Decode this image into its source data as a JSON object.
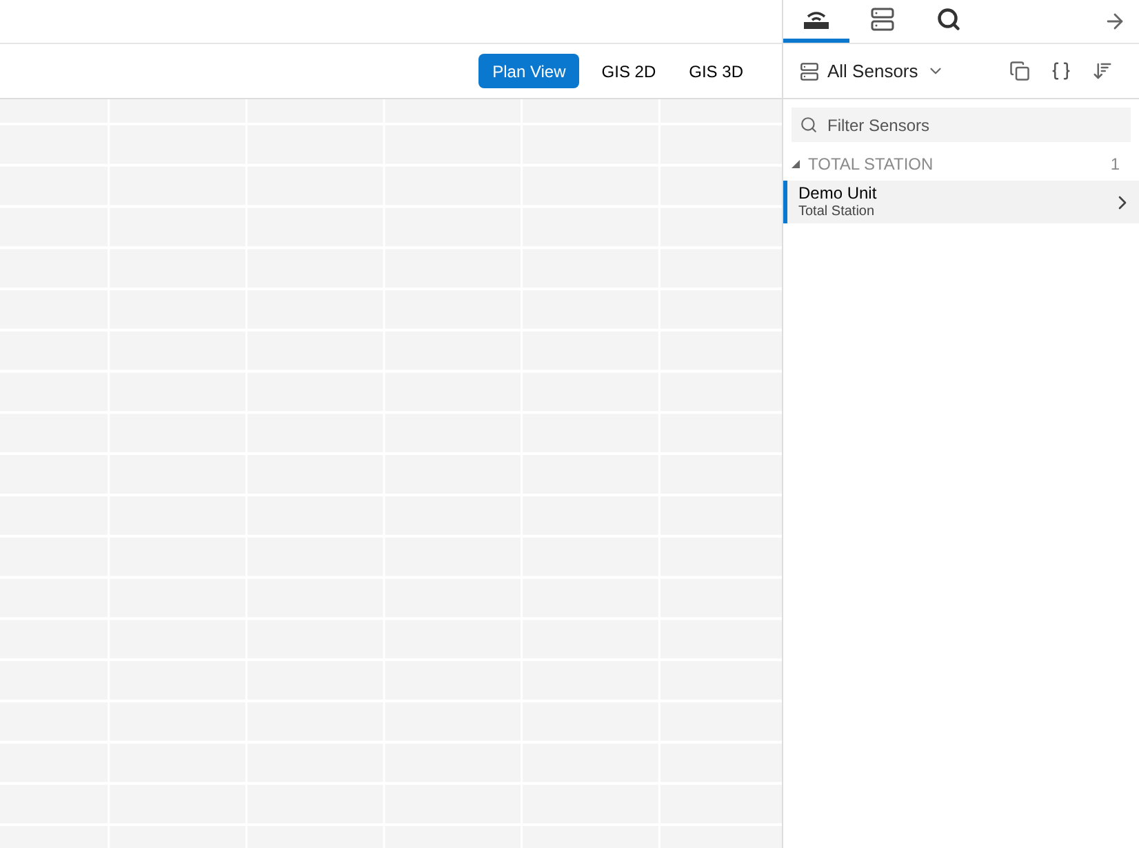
{
  "view_buttons": [
    {
      "label": "Plan View",
      "selected": true
    },
    {
      "label": "GIS 2D",
      "selected": false
    },
    {
      "label": "GIS 3D",
      "selected": false
    }
  ],
  "panel_tabs": [
    {
      "kind": "sensor",
      "selected": true
    },
    {
      "kind": "server",
      "selected": false
    },
    {
      "kind": "search",
      "selected": false
    }
  ],
  "sensor_selector": {
    "label": "All Sensors"
  },
  "filter": {
    "placeholder": "Filter Sensors"
  },
  "groups": [
    {
      "title": "TOTAL STATION",
      "count": "1",
      "expanded": true,
      "items": [
        {
          "name": "Demo Unit",
          "type": "Total Station",
          "selected": true
        }
      ]
    }
  ]
}
